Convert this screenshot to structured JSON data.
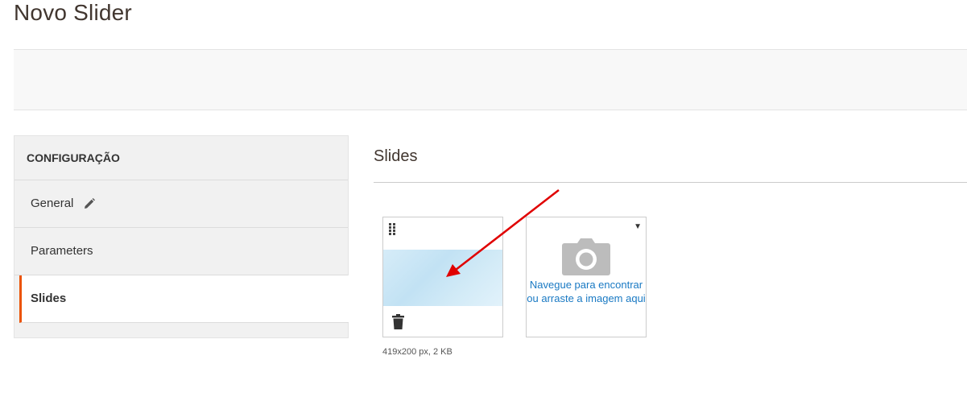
{
  "page": {
    "title": "Novo Slider"
  },
  "sidebar": {
    "heading": "CONFIGURAÇÃO",
    "items": [
      {
        "label": "General",
        "icon": "pencil-icon",
        "active": false
      },
      {
        "label": "Parameters",
        "active": false
      },
      {
        "label": "Slides",
        "active": true
      }
    ]
  },
  "main": {
    "section_title": "Slides",
    "image_card": {
      "meta": "419x200 px, 2 KB"
    },
    "upload_card": {
      "label": "Navegue para encontrar ou arraste a imagem aqui"
    }
  },
  "colors": {
    "accent": "#eb5202",
    "link": "#1979c3",
    "annotation_arrow": "#e00000"
  }
}
